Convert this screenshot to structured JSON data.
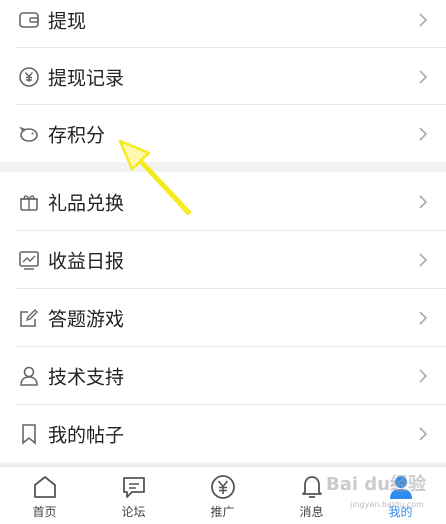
{
  "menu": {
    "items": [
      {
        "label": "提现",
        "icon": "wallet-icon"
      },
      {
        "label": "提现记录",
        "icon": "yen-coin-icon"
      },
      {
        "label": "存积分",
        "icon": "piggy-bank-icon"
      },
      {
        "label": "礼品兑换",
        "icon": "gift-icon"
      },
      {
        "label": "收益日报",
        "icon": "trend-chart-icon"
      },
      {
        "label": "答题游戏",
        "icon": "edit-note-icon"
      },
      {
        "label": "技术支持",
        "icon": "person-icon"
      },
      {
        "label": "我的帖子",
        "icon": "bookmark-icon"
      }
    ]
  },
  "tabbar": {
    "tabs": [
      {
        "label": "首页",
        "icon": "home-icon"
      },
      {
        "label": "论坛",
        "icon": "chat-bubble-icon"
      },
      {
        "label": "推广",
        "icon": "yen-circle-icon"
      },
      {
        "label": "消息",
        "icon": "bell-icon"
      },
      {
        "label": "我的",
        "icon": "profile-icon",
        "active": true
      }
    ]
  },
  "watermark": {
    "text": "Bai du经验",
    "sub": "jingyan.baidu.com"
  },
  "colors": {
    "accent": "#2d8cf0",
    "arrow": "#f5ea1a",
    "separator": "#f2f2f2"
  }
}
